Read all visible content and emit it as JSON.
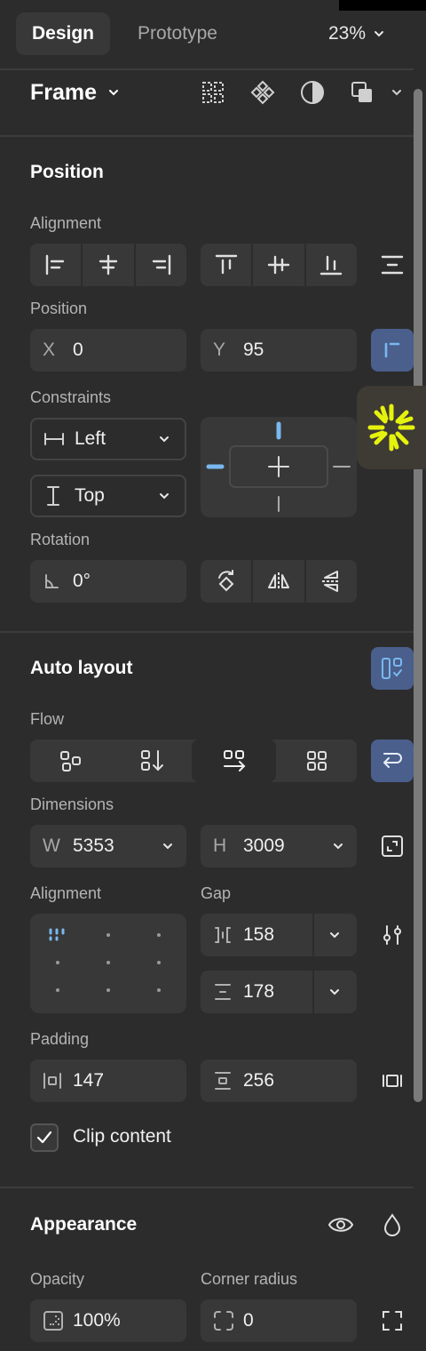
{
  "tabs": {
    "design": "Design",
    "prototype": "Prototype"
  },
  "zoom": "23%",
  "frame": {
    "title": "Frame"
  },
  "position_section": {
    "title": "Position",
    "alignment_label": "Alignment",
    "position_label": "Position",
    "x_prefix": "X",
    "x_value": "0",
    "y_prefix": "Y",
    "y_value": "95",
    "constraints_label": "Constraints",
    "horizontal_constraint": "Left",
    "vertical_constraint": "Top",
    "rotation_label": "Rotation",
    "rotation_value": "0°"
  },
  "auto_layout": {
    "title": "Auto layout",
    "flow_label": "Flow",
    "dimensions_label": "Dimensions",
    "w_prefix": "W",
    "w_value": "5353",
    "h_prefix": "H",
    "h_value": "3009",
    "alignment_label": "Alignment",
    "gap_label": "Gap",
    "gap_horizontal": "158",
    "gap_vertical": "178",
    "padding_label": "Padding",
    "padding_horizontal": "147",
    "padding_vertical": "256",
    "clip_content_label": "Clip content",
    "clip_content_checked": true
  },
  "appearance": {
    "title": "Appearance",
    "opacity_label": "Opacity",
    "opacity_value": "100%",
    "corner_radius_label": "Corner radius",
    "corner_radius_value": "0"
  },
  "colors": {
    "panel_bg": "#2c2c2c",
    "field_bg": "#383838",
    "accent_blue": "#7ab8f0",
    "active_blue_bg": "#4a5f8c",
    "plugin_yellow": "#e5f20d"
  }
}
